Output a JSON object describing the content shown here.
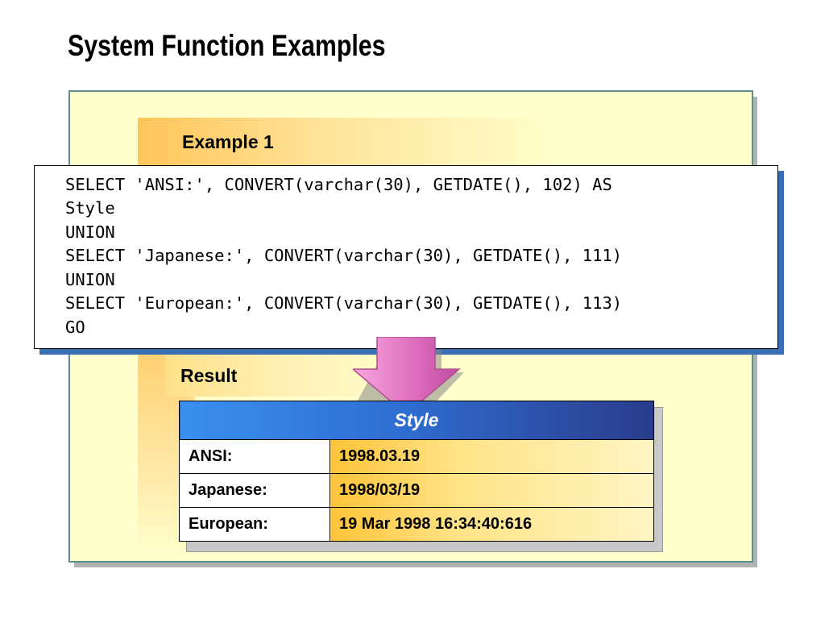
{
  "slide": {
    "title": "System Function Examples"
  },
  "example": {
    "label": "Example 1",
    "code": [
      "SELECT 'ANSI:', CONVERT(varchar(30), GETDATE(), 102) AS",
      "Style",
      "UNION",
      "SELECT 'Japanese:', CONVERT(varchar(30), GETDATE(), 111)",
      "UNION",
      "SELECT 'European:', CONVERT(varchar(30), GETDATE(), 113)",
      "GO"
    ]
  },
  "result": {
    "label": "Result",
    "header": "Style",
    "rows": [
      {
        "name": "ANSI:",
        "value": "1998.03.19"
      },
      {
        "name": "Japanese:",
        "value": "1998/03/19"
      },
      {
        "name": "European:",
        "value": "19 Mar 1998 16:34:40:616"
      }
    ]
  },
  "colors": {
    "panel_background": "#ffffcc",
    "panel_border": "#5d8f8f",
    "code_shadow": "#3a6fb3",
    "header_gradient_start": "#3a8ff0",
    "header_gradient_end": "#2a3c8c",
    "arrow": "#e070c0",
    "value_gradient_start": "#ffc43a"
  },
  "icons": {
    "arrow": "down-arrow-icon"
  }
}
